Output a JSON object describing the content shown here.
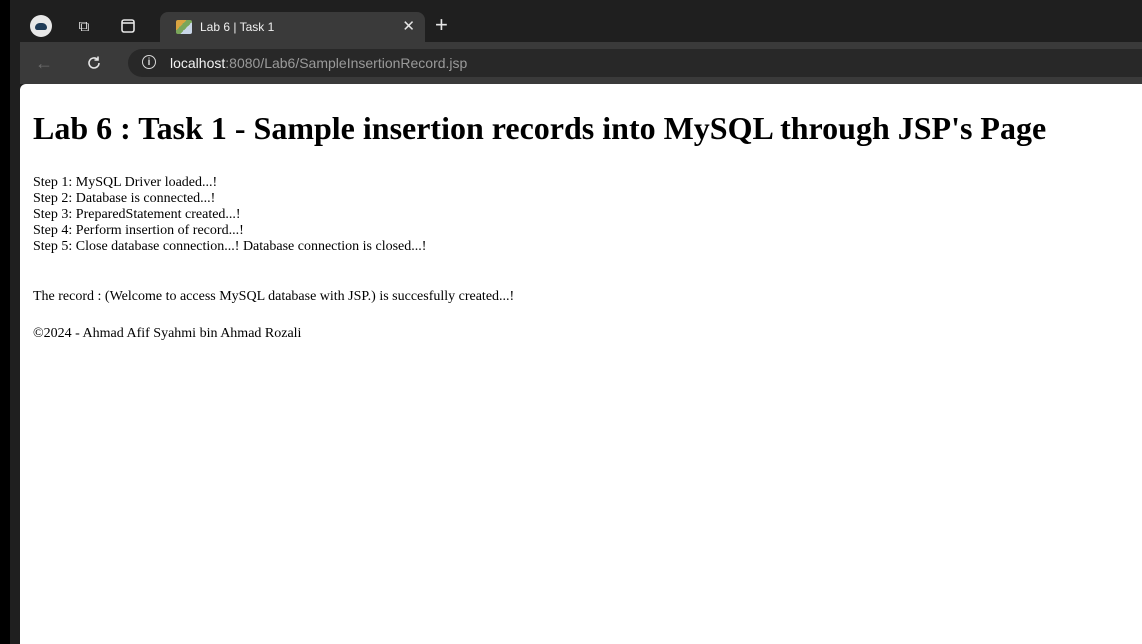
{
  "browser": {
    "tab_title": "Lab 6 | Task 1",
    "url_host": "localhost",
    "url_path": ":8080/Lab6/SampleInsertionRecord.jsp"
  },
  "page": {
    "heading": "Lab 6 : Task 1 - Sample insertion records into MySQL through JSP's Page",
    "steps": [
      "Step 1: MySQL Driver loaded...!",
      "Step 2: Database is connected...!",
      "Step 3: PreparedStatement created...!",
      "Step 4: Perform insertion of record...!",
      "Step 5: Close database connection...! Database connection is closed...!"
    ],
    "record_message": "The record : (Welcome to access MySQL database with JSP.) is succesfully created...!",
    "footer": "©2024 - Ahmad Afif Syahmi bin Ahmad Rozali"
  }
}
